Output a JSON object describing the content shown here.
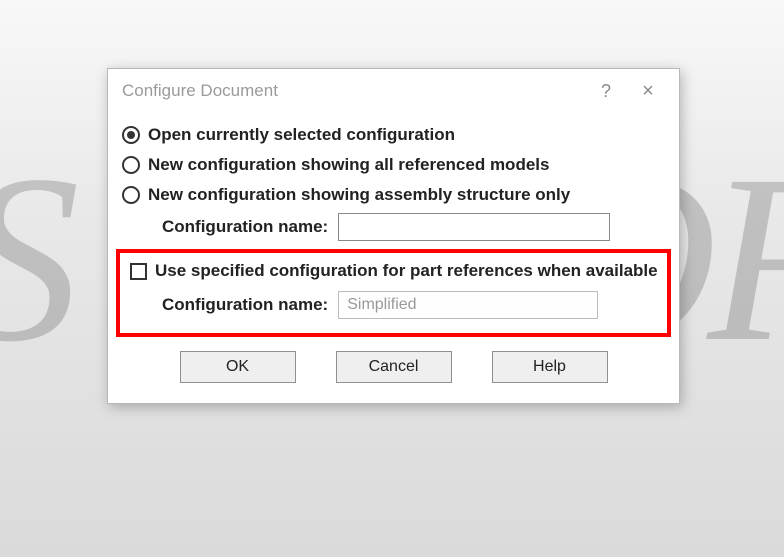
{
  "dialog": {
    "title": "Configure Document",
    "help_symbol": "?",
    "close_symbol": "×"
  },
  "radios": {
    "opt1": "Open currently selected configuration",
    "opt2": "New configuration showing all referenced models",
    "opt3": "New configuration showing assembly structure only"
  },
  "labels": {
    "config_name": "Configuration name:",
    "use_specified": "Use specified configuration for part references when available"
  },
  "inputs": {
    "config_name_value": "",
    "specified_config_value": "Simplified"
  },
  "buttons": {
    "ok": "OK",
    "cancel": "Cancel",
    "help": "Help"
  },
  "highlight_color": "#ff0000"
}
